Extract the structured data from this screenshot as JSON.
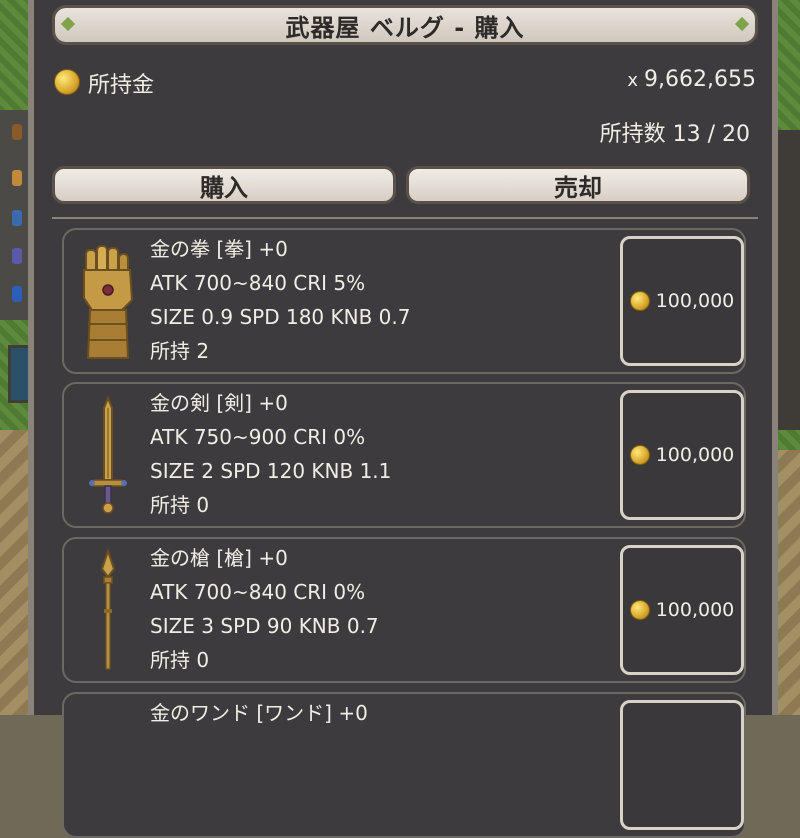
{
  "shop": {
    "title": "武器屋 ベルグ - 購入",
    "gold_label": "所持金",
    "gold_prefix": "x",
    "gold_amount": "9,662,655",
    "owned_count": "所持数 13 / 20",
    "tabs": {
      "buy": "購入",
      "sell": "売却"
    }
  },
  "items": [
    {
      "name": "金の拳 [拳] +0",
      "stats1": "ATK 700~840  CRI 5%",
      "stats2": "SIZE 0.9  SPD 180  KNB 0.7",
      "owned": "所持 2",
      "price": "100,000",
      "icon": "gold-gauntlet-icon"
    },
    {
      "name": "金の剣 [剣] +0",
      "stats1": "ATK 750~900  CRI 0%",
      "stats2": "SIZE 2  SPD 120  KNB 1.1",
      "owned": "所持 0",
      "price": "100,000",
      "icon": "gold-sword-icon"
    },
    {
      "name": "金の槍 [槍] +0",
      "stats1": "ATK 700~840  CRI 0%",
      "stats2": "SIZE 3  SPD 90  KNB 0.7",
      "owned": "所持 0",
      "price": "100,000",
      "icon": "gold-spear-icon"
    },
    {
      "name": "金のワンド [ワンド] +0",
      "icon": "gold-wand-icon"
    }
  ],
  "colors": {
    "panel": "#3d3b3e",
    "frame": "#8a837a",
    "text": "#f1ede6",
    "gold": "#d8a62a"
  }
}
